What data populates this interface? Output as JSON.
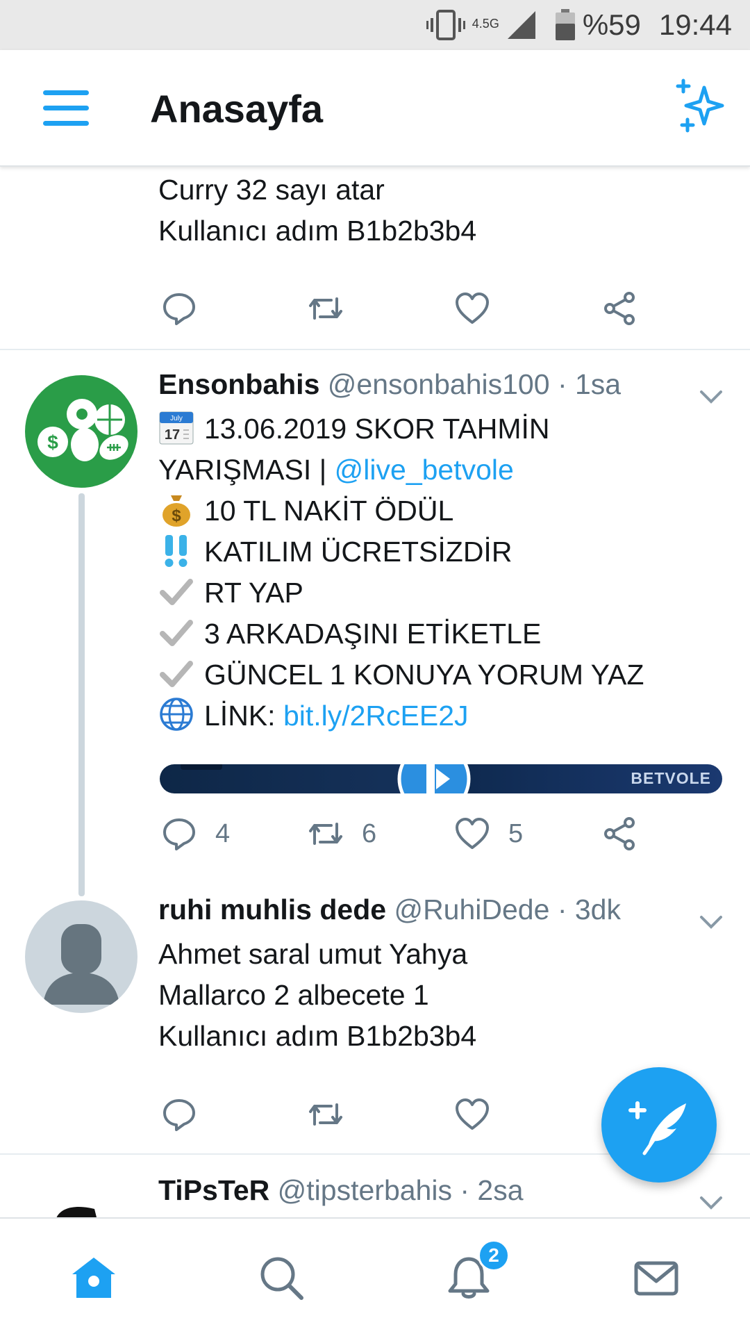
{
  "status_bar": {
    "network": "4.5G",
    "battery": "%59",
    "time": "19:44"
  },
  "header": {
    "title": "Anasayfa",
    "menu_icon": "hamburger-menu-icon",
    "sparkle_icon": "sparkle-icon"
  },
  "tweets": [
    {
      "lines": [
        "Curry 32 sayı atar",
        "Kullanıcı adım B1b2b3b4"
      ],
      "reply_count": "",
      "retweet_count": "",
      "like_count": ""
    },
    {
      "name": "Ensonbahis",
      "handle": "@ensonbahis100",
      "time": "· 1sa",
      "line1": "13.06.2019 SKOR TAHMİN",
      "line2_text": "YARIŞMASI | ",
      "line2_link": "@live_betvole",
      "line3": "10 TL NAKİT ÖDÜL",
      "line4": "KATILIM ÜCRETSİZDİR",
      "line5": "RT YAP",
      "line6": "3 ARKADAŞINI ETİKETLE",
      "line7": "GÜNCEL 1 KONUYA YORUM YAZ",
      "line8_text": "LİNK: ",
      "line8_link": "bit.ly/2RcEE2J",
      "calendar_month": "July",
      "calendar_day": "17",
      "media_brand": "BETVOLE",
      "reply_count": "4",
      "retweet_count": "6",
      "like_count": "5"
    },
    {
      "name": "ruhi muhlis dede",
      "handle": "@RuhiDede",
      "time": "· 3dk",
      "lines": [
        "Ahmet saral umut Yahya",
        "Mallarco 2 albecete 1",
        "Kullanıcı adım B1b2b3b4"
      ]
    },
    {
      "name": "TiPsTeR",
      "handle": "@tipsterbahis",
      "time": "· 2sa"
    }
  ],
  "bottom_nav": {
    "notifications_badge": "2"
  },
  "colors": {
    "accent": "#1da1f2",
    "text": "#14171a",
    "secondary": "#657786"
  }
}
